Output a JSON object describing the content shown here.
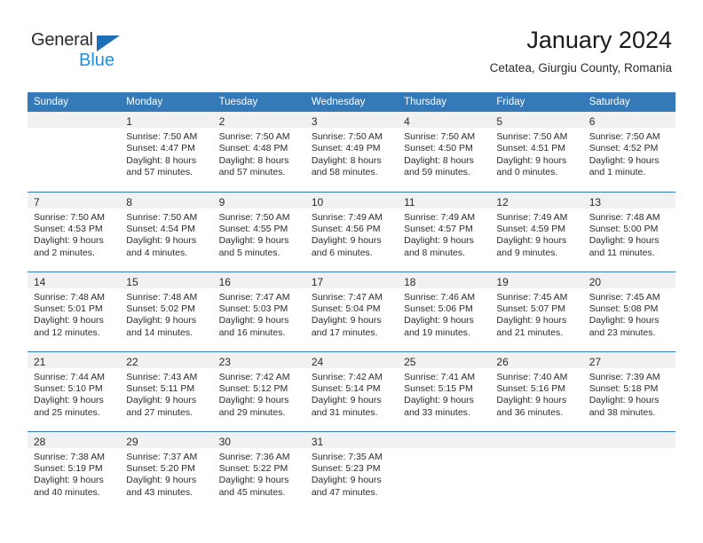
{
  "brand": {
    "name_part1": "General",
    "name_part2": "Blue",
    "logo_icon": "blue-triangle-icon",
    "accent_color": "#1d70b8",
    "blue_text_color": "#1d8fe0"
  },
  "header": {
    "title": "January 2024",
    "subtitle": "Cetatea, Giurgiu County, Romania"
  },
  "theme": {
    "header_row_color": "#3479b8",
    "daynum_band_color": "#f1f1f1",
    "text_color": "#2b2b2b"
  },
  "calendar": {
    "weekday_headers": [
      "Sunday",
      "Monday",
      "Tuesday",
      "Wednesday",
      "Thursday",
      "Friday",
      "Saturday"
    ],
    "weeks": [
      [
        {
          "day": "",
          "sunrise": "",
          "sunset": "",
          "daylight_line1": "",
          "daylight_line2": ""
        },
        {
          "day": "1",
          "sunrise": "Sunrise: 7:50 AM",
          "sunset": "Sunset: 4:47 PM",
          "daylight_line1": "Daylight: 8 hours",
          "daylight_line2": "and 57 minutes."
        },
        {
          "day": "2",
          "sunrise": "Sunrise: 7:50 AM",
          "sunset": "Sunset: 4:48 PM",
          "daylight_line1": "Daylight: 8 hours",
          "daylight_line2": "and 57 minutes."
        },
        {
          "day": "3",
          "sunrise": "Sunrise: 7:50 AM",
          "sunset": "Sunset: 4:49 PM",
          "daylight_line1": "Daylight: 8 hours",
          "daylight_line2": "and 58 minutes."
        },
        {
          "day": "4",
          "sunrise": "Sunrise: 7:50 AM",
          "sunset": "Sunset: 4:50 PM",
          "daylight_line1": "Daylight: 8 hours",
          "daylight_line2": "and 59 minutes."
        },
        {
          "day": "5",
          "sunrise": "Sunrise: 7:50 AM",
          "sunset": "Sunset: 4:51 PM",
          "daylight_line1": "Daylight: 9 hours",
          "daylight_line2": "and 0 minutes."
        },
        {
          "day": "6",
          "sunrise": "Sunrise: 7:50 AM",
          "sunset": "Sunset: 4:52 PM",
          "daylight_line1": "Daylight: 9 hours",
          "daylight_line2": "and 1 minute."
        }
      ],
      [
        {
          "day": "7",
          "sunrise": "Sunrise: 7:50 AM",
          "sunset": "Sunset: 4:53 PM",
          "daylight_line1": "Daylight: 9 hours",
          "daylight_line2": "and 2 minutes."
        },
        {
          "day": "8",
          "sunrise": "Sunrise: 7:50 AM",
          "sunset": "Sunset: 4:54 PM",
          "daylight_line1": "Daylight: 9 hours",
          "daylight_line2": "and 4 minutes."
        },
        {
          "day": "9",
          "sunrise": "Sunrise: 7:50 AM",
          "sunset": "Sunset: 4:55 PM",
          "daylight_line1": "Daylight: 9 hours",
          "daylight_line2": "and 5 minutes."
        },
        {
          "day": "10",
          "sunrise": "Sunrise: 7:49 AM",
          "sunset": "Sunset: 4:56 PM",
          "daylight_line1": "Daylight: 9 hours",
          "daylight_line2": "and 6 minutes."
        },
        {
          "day": "11",
          "sunrise": "Sunrise: 7:49 AM",
          "sunset": "Sunset: 4:57 PM",
          "daylight_line1": "Daylight: 9 hours",
          "daylight_line2": "and 8 minutes."
        },
        {
          "day": "12",
          "sunrise": "Sunrise: 7:49 AM",
          "sunset": "Sunset: 4:59 PM",
          "daylight_line1": "Daylight: 9 hours",
          "daylight_line2": "and 9 minutes."
        },
        {
          "day": "13",
          "sunrise": "Sunrise: 7:48 AM",
          "sunset": "Sunset: 5:00 PM",
          "daylight_line1": "Daylight: 9 hours",
          "daylight_line2": "and 11 minutes."
        }
      ],
      [
        {
          "day": "14",
          "sunrise": "Sunrise: 7:48 AM",
          "sunset": "Sunset: 5:01 PM",
          "daylight_line1": "Daylight: 9 hours",
          "daylight_line2": "and 12 minutes."
        },
        {
          "day": "15",
          "sunrise": "Sunrise: 7:48 AM",
          "sunset": "Sunset: 5:02 PM",
          "daylight_line1": "Daylight: 9 hours",
          "daylight_line2": "and 14 minutes."
        },
        {
          "day": "16",
          "sunrise": "Sunrise: 7:47 AM",
          "sunset": "Sunset: 5:03 PM",
          "daylight_line1": "Daylight: 9 hours",
          "daylight_line2": "and 16 minutes."
        },
        {
          "day": "17",
          "sunrise": "Sunrise: 7:47 AM",
          "sunset": "Sunset: 5:04 PM",
          "daylight_line1": "Daylight: 9 hours",
          "daylight_line2": "and 17 minutes."
        },
        {
          "day": "18",
          "sunrise": "Sunrise: 7:46 AM",
          "sunset": "Sunset: 5:06 PM",
          "daylight_line1": "Daylight: 9 hours",
          "daylight_line2": "and 19 minutes."
        },
        {
          "day": "19",
          "sunrise": "Sunrise: 7:45 AM",
          "sunset": "Sunset: 5:07 PM",
          "daylight_line1": "Daylight: 9 hours",
          "daylight_line2": "and 21 minutes."
        },
        {
          "day": "20",
          "sunrise": "Sunrise: 7:45 AM",
          "sunset": "Sunset: 5:08 PM",
          "daylight_line1": "Daylight: 9 hours",
          "daylight_line2": "and 23 minutes."
        }
      ],
      [
        {
          "day": "21",
          "sunrise": "Sunrise: 7:44 AM",
          "sunset": "Sunset: 5:10 PM",
          "daylight_line1": "Daylight: 9 hours",
          "daylight_line2": "and 25 minutes."
        },
        {
          "day": "22",
          "sunrise": "Sunrise: 7:43 AM",
          "sunset": "Sunset: 5:11 PM",
          "daylight_line1": "Daylight: 9 hours",
          "daylight_line2": "and 27 minutes."
        },
        {
          "day": "23",
          "sunrise": "Sunrise: 7:42 AM",
          "sunset": "Sunset: 5:12 PM",
          "daylight_line1": "Daylight: 9 hours",
          "daylight_line2": "and 29 minutes."
        },
        {
          "day": "24",
          "sunrise": "Sunrise: 7:42 AM",
          "sunset": "Sunset: 5:14 PM",
          "daylight_line1": "Daylight: 9 hours",
          "daylight_line2": "and 31 minutes."
        },
        {
          "day": "25",
          "sunrise": "Sunrise: 7:41 AM",
          "sunset": "Sunset: 5:15 PM",
          "daylight_line1": "Daylight: 9 hours",
          "daylight_line2": "and 33 minutes."
        },
        {
          "day": "26",
          "sunrise": "Sunrise: 7:40 AM",
          "sunset": "Sunset: 5:16 PM",
          "daylight_line1": "Daylight: 9 hours",
          "daylight_line2": "and 36 minutes."
        },
        {
          "day": "27",
          "sunrise": "Sunrise: 7:39 AM",
          "sunset": "Sunset: 5:18 PM",
          "daylight_line1": "Daylight: 9 hours",
          "daylight_line2": "and 38 minutes."
        }
      ],
      [
        {
          "day": "28",
          "sunrise": "Sunrise: 7:38 AM",
          "sunset": "Sunset: 5:19 PM",
          "daylight_line1": "Daylight: 9 hours",
          "daylight_line2": "and 40 minutes."
        },
        {
          "day": "29",
          "sunrise": "Sunrise: 7:37 AM",
          "sunset": "Sunset: 5:20 PM",
          "daylight_line1": "Daylight: 9 hours",
          "daylight_line2": "and 43 minutes."
        },
        {
          "day": "30",
          "sunrise": "Sunrise: 7:36 AM",
          "sunset": "Sunset: 5:22 PM",
          "daylight_line1": "Daylight: 9 hours",
          "daylight_line2": "and 45 minutes."
        },
        {
          "day": "31",
          "sunrise": "Sunrise: 7:35 AM",
          "sunset": "Sunset: 5:23 PM",
          "daylight_line1": "Daylight: 9 hours",
          "daylight_line2": "and 47 minutes."
        },
        {
          "day": "",
          "sunrise": "",
          "sunset": "",
          "daylight_line1": "",
          "daylight_line2": ""
        },
        {
          "day": "",
          "sunrise": "",
          "sunset": "",
          "daylight_line1": "",
          "daylight_line2": ""
        },
        {
          "day": "",
          "sunrise": "",
          "sunset": "",
          "daylight_line1": "",
          "daylight_line2": ""
        }
      ]
    ]
  }
}
